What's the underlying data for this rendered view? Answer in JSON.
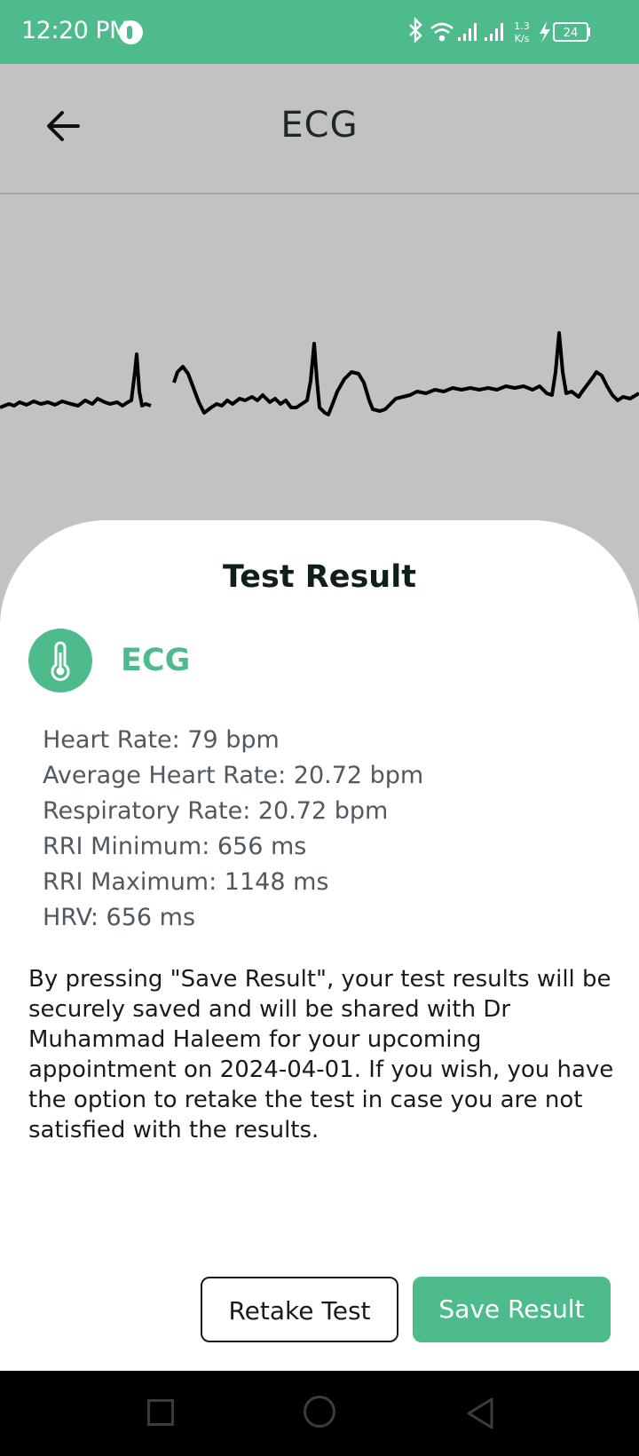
{
  "status_bar": {
    "time": "12:20 PM",
    "network_speed": "1.3 K/s",
    "battery": "24",
    "icons": [
      "app-icon",
      "bluetooth-icon",
      "wifi-icon",
      "signal-icon",
      "signal-icon",
      "charging-icon",
      "battery-icon"
    ]
  },
  "header": {
    "title": "ECG",
    "back_icon": "arrow-left-icon"
  },
  "result_sheet": {
    "title": "Test Result",
    "test_icon": "thermometer-icon",
    "test_name": "ECG",
    "metrics": [
      "Heart Rate: 79 bpm",
      "Average Heart Rate: 20.72 bpm",
      "Respiratory Rate: 20.72 bpm",
      "RRI Minimum: 656 ms",
      "RRI Maximum: 1148 ms",
      "HRV: 656 ms"
    ],
    "disclaimer": "By pressing \"Save Result\", your test results will be securely saved and will be shared with Dr Muhammad Haleem for your upcoming appointment on 2024-04-01. If you wish, you have the option to retake the test in case you are not satisfied with the results.",
    "retake_label": "Retake Test",
    "save_label": "Save Result"
  },
  "nav_bar": {
    "icons": [
      "recents-square-icon",
      "home-circle-icon",
      "back-triangle-icon"
    ]
  },
  "colors": {
    "accent": "#4dbb8b",
    "overlay_background": "#c2c2c2",
    "text_dark": "#1a1a1a",
    "metric_text": "#505860"
  }
}
